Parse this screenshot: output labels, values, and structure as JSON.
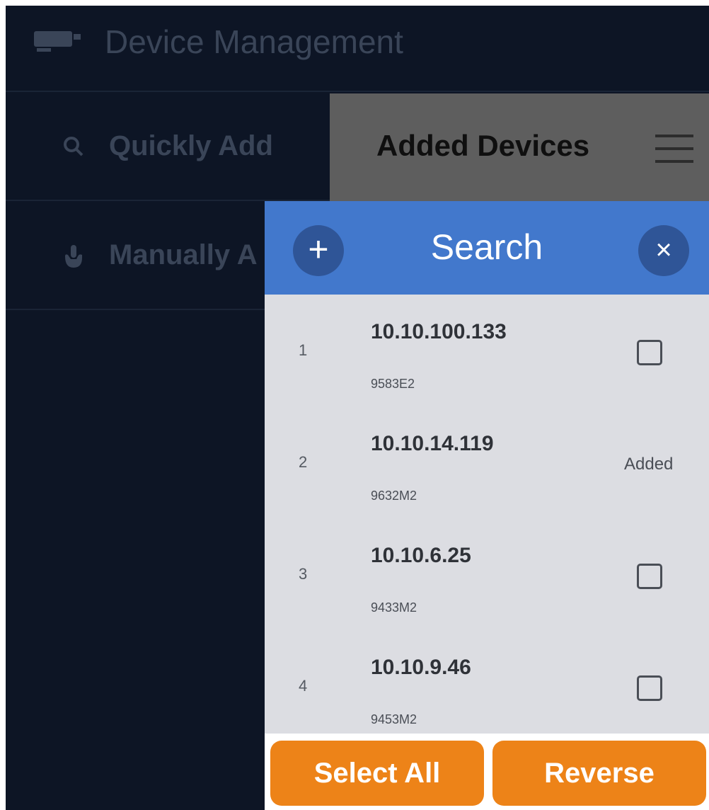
{
  "header": {
    "title": "Device Management",
    "icon": "camera-icon"
  },
  "menu": {
    "quick_add": "Quickly Add",
    "manual_add": "Manually A",
    "quick_add_icon": "search-icon",
    "manual_add_icon": "hand-icon"
  },
  "tab": {
    "label": "Added Devices",
    "menu_icon": "hamburger-icon"
  },
  "dialog": {
    "title": "Search",
    "add_glyph": "+",
    "close_glyph": "×",
    "rows": [
      {
        "num": "1",
        "ip": "10.10.100.133",
        "model": "9583E2",
        "status": ""
      },
      {
        "num": "2",
        "ip": "10.10.14.119",
        "model": "9632M2",
        "status": "Added"
      },
      {
        "num": "3",
        "ip": "10.10.6.25",
        "model": "9433M2",
        "status": ""
      },
      {
        "num": "4",
        "ip": "10.10.9.46",
        "model": "9453M2",
        "status": ""
      }
    ],
    "select_all": "Select All",
    "reverse": "Reverse"
  },
  "colors": {
    "background": "#0d1525",
    "dialog_header": "#4278cc",
    "button": "#ed8318",
    "tab": "#5e5e5e"
  }
}
